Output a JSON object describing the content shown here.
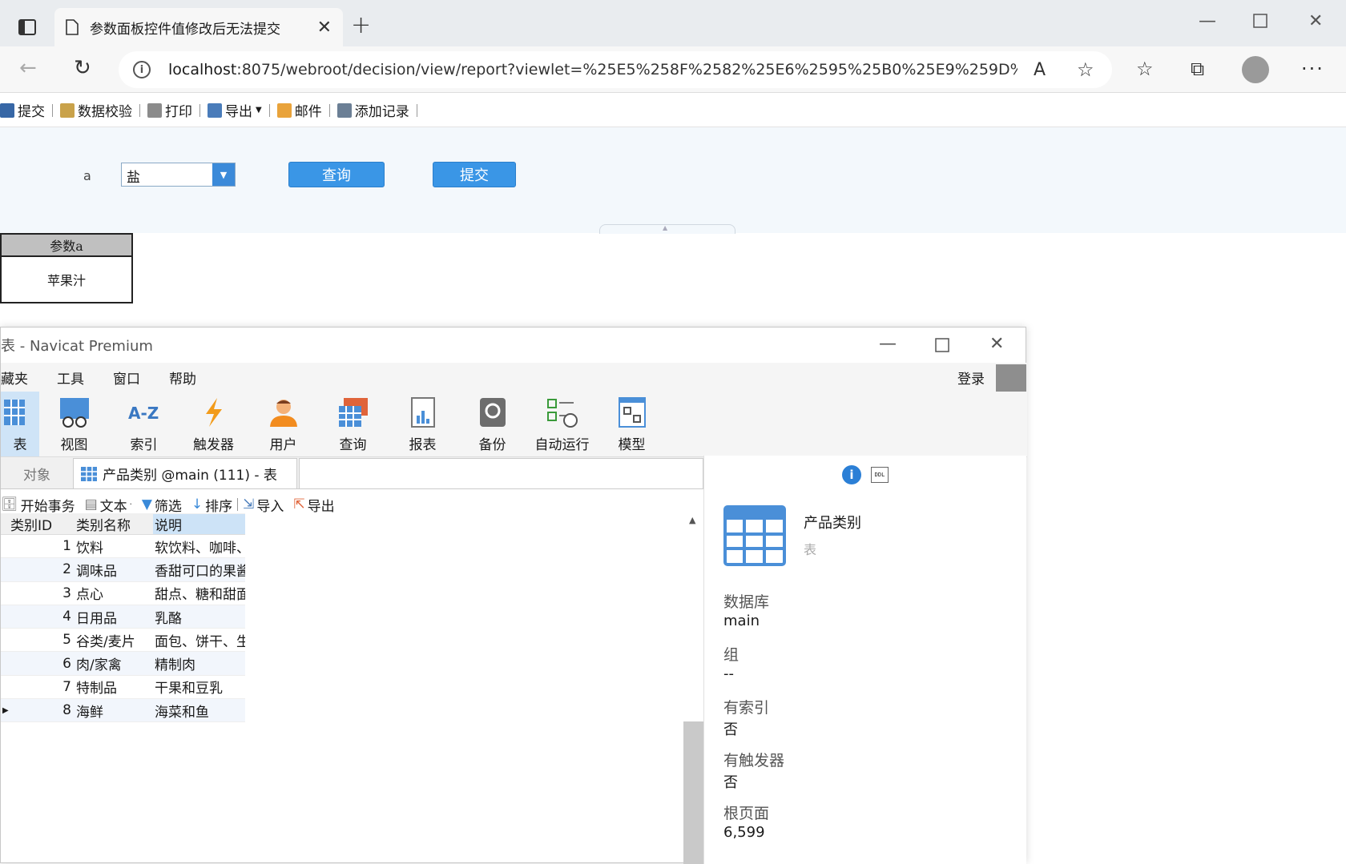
{
  "browser": {
    "tab_title": "参数面板控件值修改后无法提交",
    "url_host": "localhost",
    "url_rest": ":8075/webroot/decision/view/report?viewlet=%25E5%258F%2582%25E6%2595%25B0%25E9%259D%2..."
  },
  "report_toolbar": {
    "items": [
      "提交",
      "数据校验",
      "打印",
      "导出",
      "邮件",
      "添加记录"
    ]
  },
  "param_panel": {
    "label": "a",
    "combo_value": "盐",
    "query_button": "查询",
    "submit_button": "提交"
  },
  "report": {
    "header": "参数a",
    "value": "苹果汁"
  },
  "navicat": {
    "title": "表 - Navicat Premium",
    "menu": [
      "藏夹",
      "工具",
      "窗口",
      "帮助"
    ],
    "login": "登录",
    "ribbon": [
      "表",
      "视图",
      "索引",
      "触发器",
      "用户",
      "查询",
      "报表",
      "备份",
      "自动运行",
      "模型"
    ],
    "tab_object": "对象",
    "tab_table": "产品类别 @main (111) - 表",
    "toolbar": [
      "开始事务",
      "文本",
      "筛选",
      "排序",
      "导入",
      "导出"
    ],
    "grid": {
      "columns": [
        "类别ID",
        "类别名称",
        "说明"
      ],
      "rows": [
        [
          "1",
          "饮料",
          "软饮料、咖啡、"
        ],
        [
          "2",
          "调味品",
          "香甜可口的果酱"
        ],
        [
          "3",
          "点心",
          "甜点、糖和甜面"
        ],
        [
          "4",
          "日用品",
          "乳酪"
        ],
        [
          "5",
          "谷类/麦片",
          "面包、饼干、生"
        ],
        [
          "6",
          "肉/家禽",
          "精制肉"
        ],
        [
          "7",
          "特制品",
          "干果和豆乳"
        ],
        [
          "8",
          "海鲜",
          "海菜和鱼"
        ]
      ]
    },
    "info": {
      "name": "产品类别",
      "type": "表",
      "db_label": "数据库",
      "db_value": "main",
      "group_label": "组",
      "group_value": "--",
      "index_label": "有索引",
      "index_value": "否",
      "trigger_label": "有触发器",
      "trigger_value": "否",
      "rootpage_label": "根页面",
      "rootpage_value": "6,599",
      "ddl_label": "DDL"
    }
  }
}
